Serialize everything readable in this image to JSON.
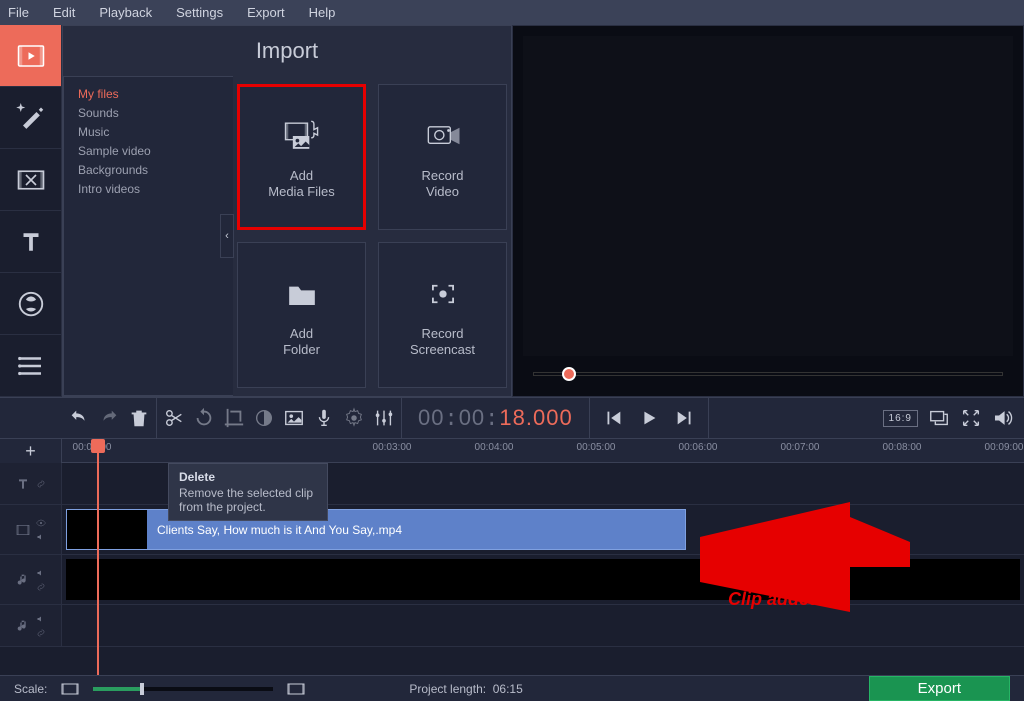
{
  "menu": {
    "file": "File",
    "edit": "Edit",
    "playback": "Playback",
    "settings": "Settings",
    "export": "Export",
    "help": "Help"
  },
  "import": {
    "title": "Import",
    "categories": [
      "My files",
      "Sounds",
      "Music",
      "Sample video",
      "Backgrounds",
      "Intro videos"
    ],
    "cards": {
      "add_media": {
        "line1": "Add",
        "line2": "Media Files"
      },
      "record_video": {
        "line1": "Record",
        "line2": "Video"
      },
      "add_folder": {
        "line1": "Add",
        "line2": "Folder"
      },
      "record_screencast": {
        "line1": "Record",
        "line2": "Screencast"
      }
    }
  },
  "tooltip": {
    "title": "Delete",
    "body": "Remove the selected clip from the project."
  },
  "timecode": {
    "h": "00",
    "m": "00",
    "s": "18",
    "ms": "000"
  },
  "timeline": {
    "start_label": "00:00:00",
    "marks": [
      "00:03:00",
      "00:04:00",
      "00:05:00",
      "00:06:00",
      "00:07:00",
      "00:08:00",
      "00:09:00"
    ],
    "clip_name": "Clients Say, How much is it And You Say,.mp4"
  },
  "annotation": "Clip added",
  "aspect": "16:9",
  "footer": {
    "scale_label": "Scale:",
    "project_length_label": "Project length:",
    "project_length_value": "06:15",
    "export": "Export"
  }
}
